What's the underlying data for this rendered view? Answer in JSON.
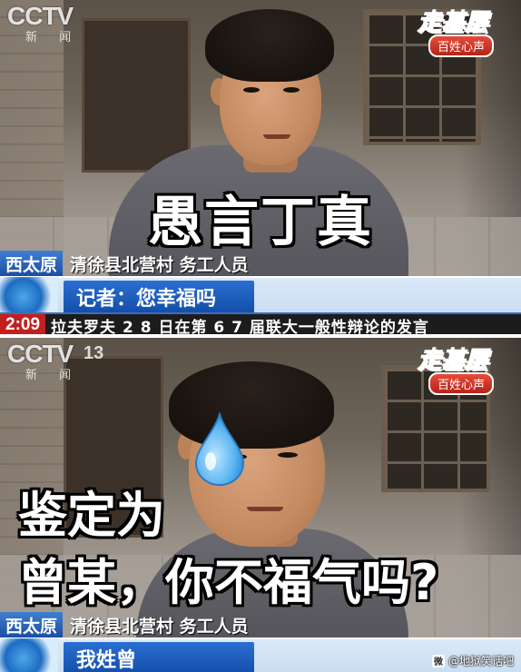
{
  "top_panel": {
    "broadcaster_logo": "CCTV",
    "broadcaster_sub": "新 闻",
    "program_title": "走基层",
    "program_tag": "百姓心声",
    "caption": "愚言丁真",
    "location_tag": "西太原",
    "location_text": "清徐县北营村  务工人员",
    "quote_text": "记者：您幸福吗",
    "ticker_time": "2:09",
    "ticker_text": "拉夫罗夫 2 8 日在第 6 7 届联大一般性辩论的发言"
  },
  "bottom_panel": {
    "broadcaster_logo": "CCTV",
    "broadcaster_sub": "新 闻",
    "channel_number": "13",
    "program_title": "走基层",
    "program_tag": "百姓心声",
    "caption_line1": "鉴定为",
    "caption_line2": "曾某，你不福气吗?",
    "location_tag": "西太原",
    "location_text": "清徐县北营村  务工人员",
    "quote_text": "我姓曾",
    "sweat_drop_icon": "sweat-drop-icon",
    "sweat_drop_color": "#5ab4f0"
  },
  "watermark": {
    "icon": "weibo-icon",
    "text": "@地狱笑话吧"
  },
  "colors": {
    "caption_fill": "#ffffff",
    "caption_stroke": "#000000",
    "news_blue": "#1c4ea3",
    "ticker_red": "#c41e1e",
    "program_green": "#2f9c3b"
  }
}
